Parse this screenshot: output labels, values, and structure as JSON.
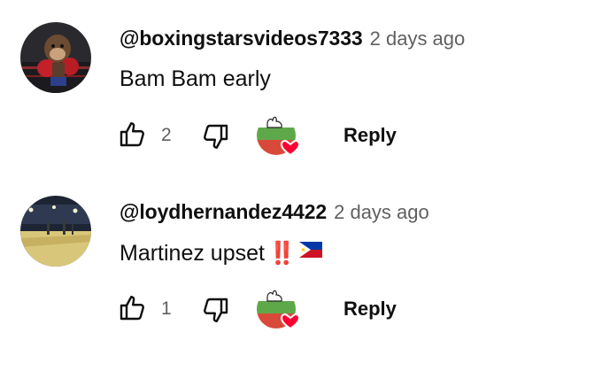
{
  "comments": [
    {
      "author": "@boxingstarsvideos7333",
      "time": "2 days ago",
      "text": "Bam Bam early",
      "likes": "2",
      "reply_label": "Reply",
      "hearted_by_creator": true,
      "avatar_icon": "boxing-monkey-avatar"
    },
    {
      "author": "@loydhernandez4422",
      "time": "2 days ago",
      "text": "Martinez upset",
      "emoji": [
        "double-exclamation-mark",
        "philippines-flag"
      ],
      "emoji_text": "‼️",
      "likes": "1",
      "reply_label": "Reply",
      "hearted_by_creator": true,
      "avatar_icon": "arena-avatar"
    }
  ],
  "icons": {
    "like": "thumbs-up-icon",
    "dislike": "thumbs-down-icon",
    "creator_heart": "creator-heart-icon"
  },
  "colors": {
    "heart": "#ff0033",
    "channel_green": "#5fa84a",
    "channel_red": "#d9493a",
    "muted_text": "#606060"
  }
}
